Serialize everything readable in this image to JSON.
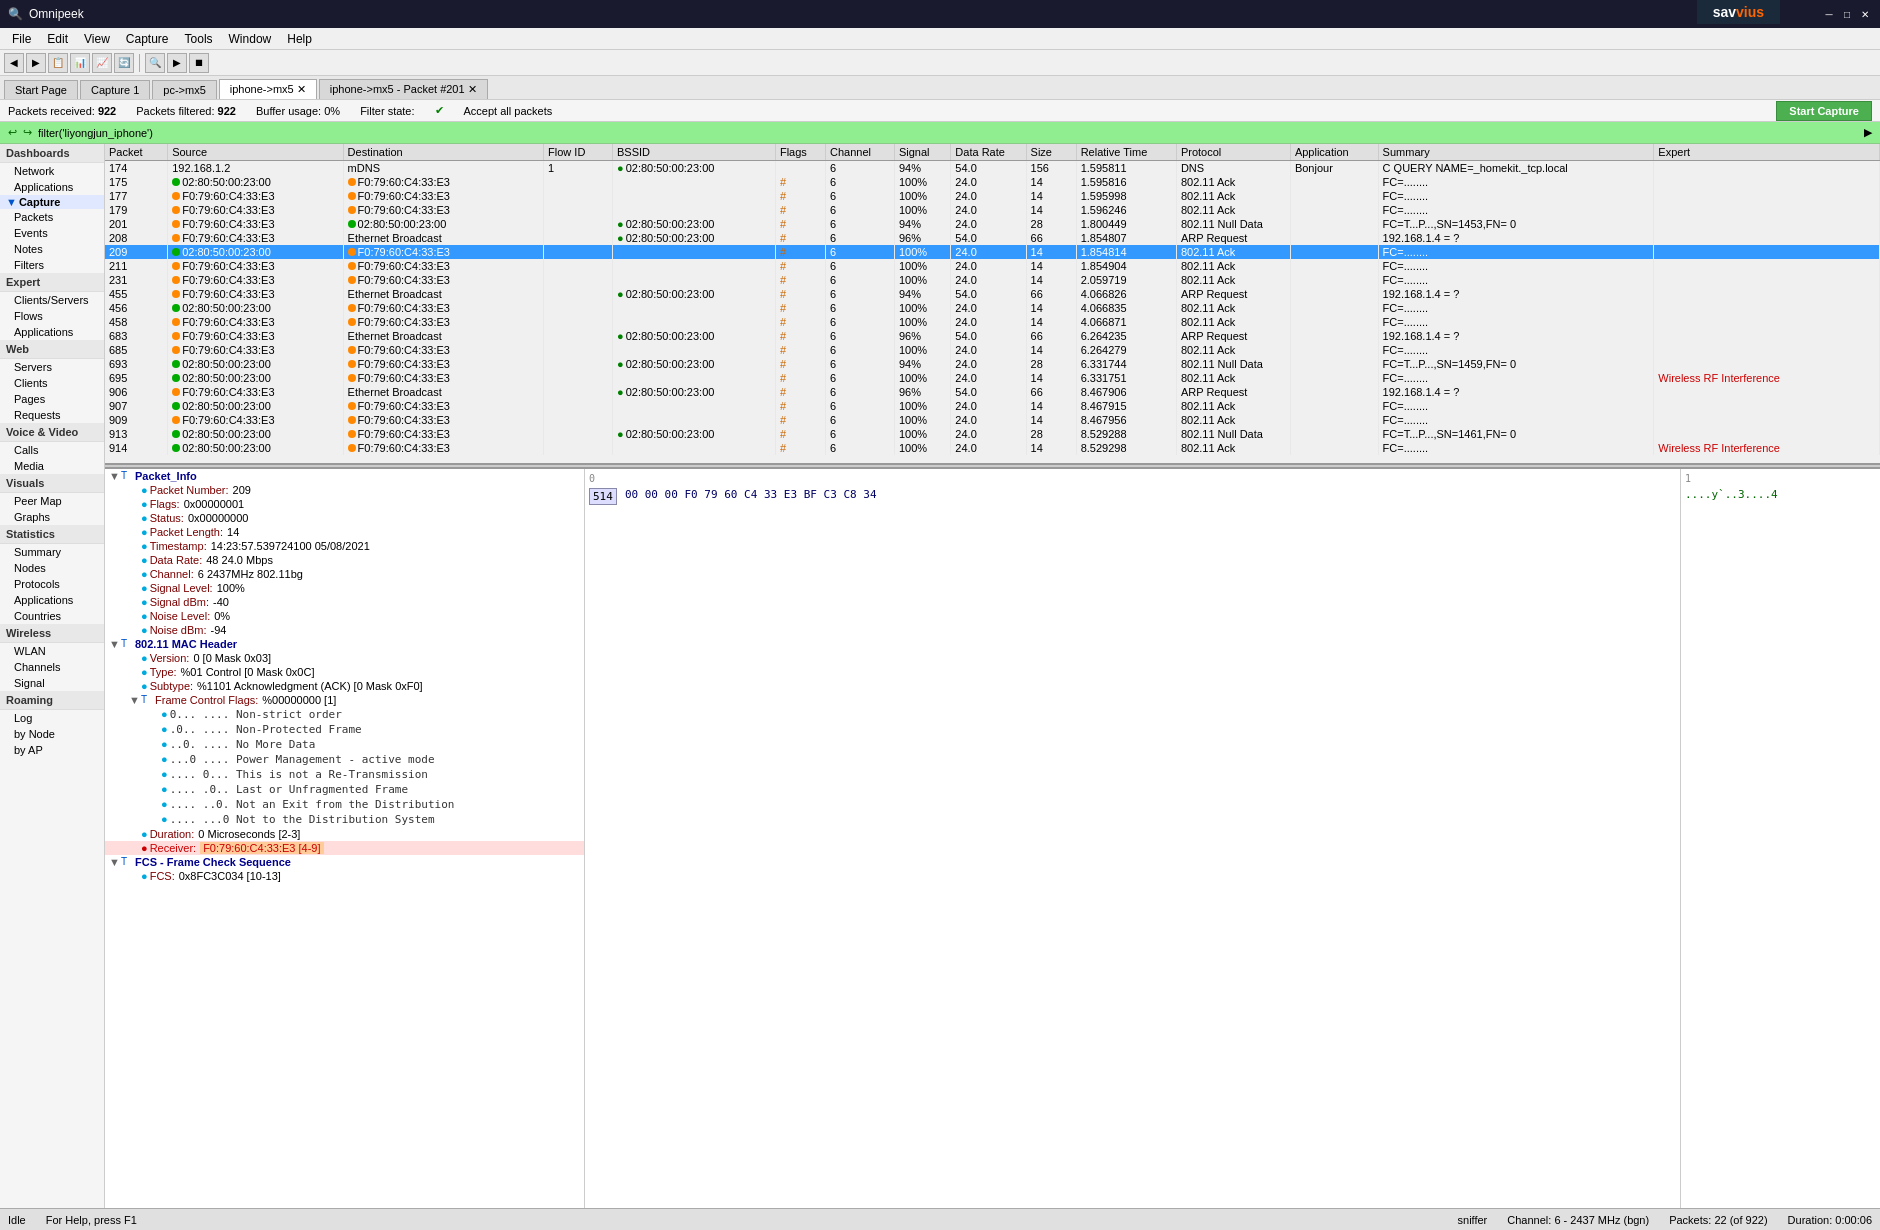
{
  "titlebar": {
    "title": "Omnipeek",
    "min_btn": "─",
    "max_btn": "□",
    "close_btn": "✕"
  },
  "menubar": {
    "items": [
      "File",
      "Edit",
      "View",
      "Capture",
      "Tools",
      "Window",
      "Help"
    ]
  },
  "tabs": [
    {
      "label": "Start Page",
      "active": false
    },
    {
      "label": "Capture 1",
      "active": false
    },
    {
      "label": "pc->mx5",
      "active": false
    },
    {
      "label": "iphone->mx5",
      "active": true
    },
    {
      "label": "iphone->mx5 - Packet #201",
      "active": false
    }
  ],
  "status": {
    "packets_received_label": "Packets received:",
    "packets_received_val": "922",
    "packets_filtered_label": "Packets filtered:",
    "packets_filtered_val": "922",
    "buffer_usage_label": "Buffer usage:",
    "buffer_usage_val": "0%",
    "filter_state_label": "Filter state:",
    "filter_state_val": "Accept all packets",
    "start_capture_btn": "Start Capture"
  },
  "filter_bar": {
    "text": "filter('liyongjun_iphone')"
  },
  "sidebar": {
    "sections": [
      {
        "label": "Dashboards",
        "items": [
          "Network",
          "Applications"
        ]
      },
      {
        "label": "Capture",
        "items": [
          "Packets",
          "Events",
          "Notes",
          "Filters"
        ]
      },
      {
        "label": "Expert",
        "items": [
          "Clients/Servers",
          "Flows",
          "Applications"
        ]
      },
      {
        "label": "Web",
        "items": [
          "Servers",
          "Clients",
          "Pages",
          "Requests"
        ]
      },
      {
        "label": "Voice & Video",
        "items": [
          "Calls",
          "Media"
        ]
      },
      {
        "label": "Visuals",
        "items": [
          "Peer Map",
          "Graphs"
        ]
      },
      {
        "label": "Statistics",
        "items": [
          "Summary",
          "Nodes",
          "Protocols",
          "Applications",
          "Countries"
        ]
      },
      {
        "label": "Wireless",
        "items": [
          "WLAN",
          "Channels",
          "Signal"
        ]
      },
      {
        "label": "Roaming",
        "items": [
          "Log",
          "by Node",
          "by AP"
        ]
      }
    ]
  },
  "packet_table": {
    "columns": [
      "Packet",
      "Source",
      "Destination",
      "Flow ID",
      "BSSID",
      "Flags",
      "Channel",
      "Signal",
      "Data Rate",
      "Size",
      "Relative Time",
      "Protocol",
      "Application",
      "Summary",
      "Expert"
    ],
    "rows": [
      {
        "id": 174,
        "source": "192.168.1.2",
        "dest": "mDNS",
        "flow_id": "1",
        "bssid": "02:80:50:00:23:00",
        "flags": "",
        "channel": "6",
        "signal": "94%",
        "data_rate": "54.0",
        "size": "156",
        "rel_time": "1.595811",
        "protocol": "DNS",
        "application": "Bonjour",
        "summary": "C QUERY NAME=_homekit._tcp.local",
        "expert": "",
        "src_dot": "none",
        "dst_dot": "none"
      },
      {
        "id": 175,
        "source": "02:80:50:00:23:00",
        "dest": "F0:79:60:C4:33:E3",
        "flow_id": "",
        "bssid": "",
        "flags": "#",
        "channel": "6",
        "signal": "100%",
        "data_rate": "24.0",
        "size": "14",
        "rel_time": "1.595816",
        "protocol": "802.11 Ack",
        "application": "",
        "summary": "FC=........",
        "expert": "",
        "src_dot": "green",
        "dst_dot": "orange"
      },
      {
        "id": 177,
        "source": "F0:79:60:C4:33:E3",
        "dest": "F0:79:60:C4:33:E3",
        "flow_id": "",
        "bssid": "",
        "flags": "#",
        "channel": "6",
        "signal": "100%",
        "data_rate": "24.0",
        "size": "14",
        "rel_time": "1.595998",
        "protocol": "802.11 Ack",
        "application": "",
        "summary": "FC=........",
        "expert": "",
        "src_dot": "orange",
        "dst_dot": "orange"
      },
      {
        "id": 179,
        "source": "F0:79:60:C4:33:E3",
        "dest": "F0:79:60:C4:33:E3",
        "flow_id": "",
        "bssid": "",
        "flags": "#",
        "channel": "6",
        "signal": "100%",
        "data_rate": "24.0",
        "size": "14",
        "rel_time": "1.596246",
        "protocol": "802.11 Ack",
        "application": "",
        "summary": "FC=........",
        "expert": "",
        "src_dot": "orange",
        "dst_dot": "orange"
      },
      {
        "id": 201,
        "source": "F0:79:60:C4:33:E3",
        "dest": "02:80:50:00:23:00",
        "flow_id": "",
        "bssid": "02:80:50:00:23:00",
        "flags": "#",
        "channel": "6",
        "signal": "94%",
        "data_rate": "24.0",
        "size": "28",
        "rel_time": "1.800449",
        "protocol": "802.11 Null Data",
        "application": "",
        "summary": "FC=T...P...,SN=1453,FN= 0",
        "expert": "",
        "src_dot": "orange",
        "dst_dot": "green"
      },
      {
        "id": 208,
        "source": "F0:79:60:C4:33:E3",
        "dest": "Ethernet Broadcast",
        "flow_id": "",
        "bssid": "02:80:50:00:23:00",
        "flags": "#",
        "channel": "6",
        "signal": "96%",
        "data_rate": "54.0",
        "size": "66",
        "rel_time": "1.854807",
        "protocol": "ARP Request",
        "application": "",
        "summary": "192.168.1.4 = ?",
        "expert": "",
        "src_dot": "orange",
        "dst_dot": "none"
      },
      {
        "id": 209,
        "source": "02:80:50:00:23:00",
        "dest": "F0:79:60:C4:33:E3",
        "flow_id": "",
        "bssid": "",
        "flags": "#",
        "channel": "6",
        "signal": "100%",
        "data_rate": "24.0",
        "size": "14",
        "rel_time": "1.854814",
        "protocol": "802.11 Ack",
        "application": "",
        "summary": "FC=........",
        "expert": "",
        "src_dot": "green",
        "dst_dot": "orange",
        "selected": true
      },
      {
        "id": 211,
        "source": "F0:79:60:C4:33:E3",
        "dest": "F0:79:60:C4:33:E3",
        "flow_id": "",
        "bssid": "",
        "flags": "#",
        "channel": "6",
        "signal": "100%",
        "data_rate": "24.0",
        "size": "14",
        "rel_time": "1.854904",
        "protocol": "802.11 Ack",
        "application": "",
        "summary": "FC=........",
        "expert": "",
        "src_dot": "orange",
        "dst_dot": "orange"
      },
      {
        "id": 231,
        "source": "F0:79:60:C4:33:E3",
        "dest": "F0:79:60:C4:33:E3",
        "flow_id": "",
        "bssid": "",
        "flags": "#",
        "channel": "6",
        "signal": "100%",
        "data_rate": "24.0",
        "size": "14",
        "rel_time": "2.059719",
        "protocol": "802.11 Ack",
        "application": "",
        "summary": "FC=........",
        "expert": "",
        "src_dot": "orange",
        "dst_dot": "orange"
      },
      {
        "id": 455,
        "source": "F0:79:60:C4:33:E3",
        "dest": "Ethernet Broadcast",
        "flow_id": "",
        "bssid": "02:80:50:00:23:00",
        "flags": "#",
        "channel": "6",
        "signal": "94%",
        "data_rate": "54.0",
        "size": "66",
        "rel_time": "4.066826",
        "protocol": "ARP Request",
        "application": "",
        "summary": "192.168.1.4 = ?",
        "expert": "",
        "src_dot": "orange",
        "dst_dot": "none"
      },
      {
        "id": 456,
        "source": "02:80:50:00:23:00",
        "dest": "F0:79:60:C4:33:E3",
        "flow_id": "",
        "bssid": "",
        "flags": "#",
        "channel": "6",
        "signal": "100%",
        "data_rate": "24.0",
        "size": "14",
        "rel_time": "4.066835",
        "protocol": "802.11 Ack",
        "application": "",
        "summary": "FC=........",
        "expert": "",
        "src_dot": "green",
        "dst_dot": "orange"
      },
      {
        "id": 458,
        "source": "F0:79:60:C4:33:E3",
        "dest": "F0:79:60:C4:33:E3",
        "flow_id": "",
        "bssid": "",
        "flags": "#",
        "channel": "6",
        "signal": "100%",
        "data_rate": "24.0",
        "size": "14",
        "rel_time": "4.066871",
        "protocol": "802.11 Ack",
        "application": "",
        "summary": "FC=........",
        "expert": "",
        "src_dot": "orange",
        "dst_dot": "orange"
      },
      {
        "id": 683,
        "source": "F0:79:60:C4:33:E3",
        "dest": "Ethernet Broadcast",
        "flow_id": "",
        "bssid": "02:80:50:00:23:00",
        "flags": "#",
        "channel": "6",
        "signal": "96%",
        "data_rate": "54.0",
        "size": "66",
        "rel_time": "6.264235",
        "protocol": "ARP Request",
        "application": "",
        "summary": "192.168.1.4 = ?",
        "expert": "",
        "src_dot": "orange",
        "dst_dot": "none"
      },
      {
        "id": 685,
        "source": "F0:79:60:C4:33:E3",
        "dest": "F0:79:60:C4:33:E3",
        "flow_id": "",
        "bssid": "",
        "flags": "#",
        "channel": "6",
        "signal": "100%",
        "data_rate": "24.0",
        "size": "14",
        "rel_time": "6.264279",
        "protocol": "802.11 Ack",
        "application": "",
        "summary": "FC=........",
        "expert": "",
        "src_dot": "orange",
        "dst_dot": "orange"
      },
      {
        "id": 693,
        "source": "02:80:50:00:23:00",
        "dest": "F0:79:60:C4:33:E3",
        "flow_id": "",
        "bssid": "02:80:50:00:23:00",
        "flags": "#",
        "channel": "6",
        "signal": "94%",
        "data_rate": "24.0",
        "size": "28",
        "rel_time": "6.331744",
        "protocol": "802.11 Null Data",
        "application": "",
        "summary": "FC=T...P...,SN=1459,FN= 0",
        "expert": "",
        "src_dot": "green",
        "dst_dot": "orange"
      },
      {
        "id": 695,
        "source": "02:80:50:00:23:00",
        "dest": "F0:79:60:C4:33:E3",
        "flow_id": "",
        "bssid": "",
        "flags": "#",
        "channel": "6",
        "signal": "100%",
        "data_rate": "24.0",
        "size": "14",
        "rel_time": "6.331751",
        "protocol": "802.11 Ack",
        "application": "",
        "summary": "FC=........",
        "expert": "Wireless RF Interference",
        "src_dot": "green",
        "dst_dot": "orange"
      },
      {
        "id": 906,
        "source": "F0:79:60:C4:33:E3",
        "dest": "Ethernet Broadcast",
        "flow_id": "",
        "bssid": "02:80:50:00:23:00",
        "flags": "#",
        "channel": "6",
        "signal": "96%",
        "data_rate": "54.0",
        "size": "66",
        "rel_time": "8.467906",
        "protocol": "ARP Request",
        "application": "",
        "summary": "192.168.1.4 = ?",
        "expert": "",
        "src_dot": "orange",
        "dst_dot": "none"
      },
      {
        "id": 907,
        "source": "02:80:50:00:23:00",
        "dest": "F0:79:60:C4:33:E3",
        "flow_id": "",
        "bssid": "",
        "flags": "#",
        "channel": "6",
        "signal": "100%",
        "data_rate": "24.0",
        "size": "14",
        "rel_time": "8.467915",
        "protocol": "802.11 Ack",
        "application": "",
        "summary": "FC=........",
        "expert": "",
        "src_dot": "green",
        "dst_dot": "orange"
      },
      {
        "id": 909,
        "source": "F0:79:60:C4:33:E3",
        "dest": "F0:79:60:C4:33:E3",
        "flow_id": "",
        "bssid": "",
        "flags": "#",
        "channel": "6",
        "signal": "100%",
        "data_rate": "24.0",
        "size": "14",
        "rel_time": "8.467956",
        "protocol": "802.11 Ack",
        "application": "",
        "summary": "FC=........",
        "expert": "",
        "src_dot": "orange",
        "dst_dot": "orange"
      },
      {
        "id": 913,
        "source": "02:80:50:00:23:00",
        "dest": "F0:79:60:C4:33:E3",
        "flow_id": "",
        "bssid": "02:80:50:00:23:00",
        "flags": "#",
        "channel": "6",
        "signal": "100%",
        "data_rate": "24.0",
        "size": "28",
        "rel_time": "8.529288",
        "protocol": "802.11 Null Data",
        "application": "",
        "summary": "FC=T...P...,SN=1461,FN= 0",
        "expert": "",
        "src_dot": "green",
        "dst_dot": "orange"
      },
      {
        "id": 914,
        "source": "02:80:50:00:23:00",
        "dest": "F0:79:60:C4:33:E3",
        "flow_id": "",
        "bssid": "",
        "flags": "#",
        "channel": "6",
        "signal": "100%",
        "data_rate": "24.0",
        "size": "14",
        "rel_time": "8.529298",
        "protocol": "802.11 Ack",
        "application": "",
        "summary": "FC=........",
        "expert": "Wireless RF Interference",
        "src_dot": "green",
        "dst_dot": "orange"
      }
    ]
  },
  "detail_tree": {
    "packet_info": {
      "label": "Packet_Info",
      "fields": [
        {
          "name": "Packet Number:",
          "value": "209"
        },
        {
          "name": "Flags:",
          "value": "0x00000001"
        },
        {
          "name": "Status:",
          "value": "0x00000000"
        },
        {
          "name": "Packet Length:",
          "value": "14"
        },
        {
          "name": "Timestamp:",
          "value": "14:23:57.539724100 05/08/2021"
        },
        {
          "name": "Data Rate:",
          "value": "48  24.0 Mbps"
        },
        {
          "name": "Channel:",
          "value": "6  2437MHz  802.11bg"
        },
        {
          "name": "Signal Level:",
          "value": "100%"
        },
        {
          "name": "Signal dBm:",
          "value": "-40"
        },
        {
          "name": "Noise Level:",
          "value": "0%"
        },
        {
          "name": "Noise dBm:",
          "value": "-94"
        }
      ]
    },
    "mac_header": {
      "label": "802.11 MAC Header",
      "fields": [
        {
          "name": "Version:",
          "value": "0  [0 Mask 0x03]"
        },
        {
          "name": "Type:",
          "value": "%01  Control [0 Mask 0x0C]"
        },
        {
          "name": "Subtype:",
          "value": "%1101  Acknowledgment (ACK) [0 Mask 0xF0]"
        }
      ]
    },
    "frame_control": {
      "label": "Frame Control Flags:",
      "value": "%00000000 [1]",
      "bits": [
        "0... .... Non-strict order",
        ".0.. .... Non-Protected Frame",
        "..0. .... No More Data",
        "...0 .... Power Management - active mode",
        ".... 0... This is not a Re-Transmission",
        ".... .0.. Last or Unfragmented Frame",
        ".... ..0. Not an Exit from the Distribution",
        ".... ...0 Not to the Distribution System"
      ]
    },
    "duration": {
      "name": "Duration:",
      "value": "0  Microseconds [2-3]"
    },
    "receiver": {
      "name": "Receiver:",
      "value": "F0:79:60:C4:33:E3 [4-9]",
      "highlight": true
    },
    "fcs": {
      "label": "FCS - Frame Check Sequence",
      "fields": [
        {
          "name": "FCS:",
          "value": "0x8FC3C034 [10-13]"
        }
      ]
    }
  },
  "hex_view": {
    "offset": "0",
    "hex_data": "00 00 00 F0 79 60 C4 33 E3 BF C3 C8 34",
    "ascii_data": "....y`..3....4"
  },
  "bottom_status": {
    "idle": "Idle",
    "help": "For Help, press F1",
    "sniffer": "sniffer",
    "channel": "Channel: 6 - 2437 MHz (bgn)",
    "packets": "Packets: 22 (of 922)",
    "duration": "Duration: 0:00:06"
  }
}
